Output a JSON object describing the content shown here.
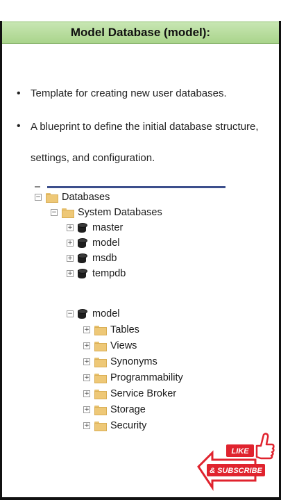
{
  "title": "Model Database (model):",
  "bullets": [
    "Template for creating new user databases.",
    "A blueprint to define the initial database structure, settings, and configuration."
  ],
  "tree": {
    "databases": "Databases",
    "system_databases": "System Databases",
    "system_items": [
      "master",
      "model",
      "msdb",
      "tempdb"
    ],
    "model_node": "model",
    "model_children": [
      "Tables",
      "Views",
      "Synonyms",
      "Programmability",
      "Service Broker",
      "Storage",
      "Security"
    ]
  },
  "badge": {
    "like": "LIKE",
    "subscribe": "& SUBSCRIBE",
    "colors": {
      "red": "#e0232e",
      "white": "#ffffff"
    }
  },
  "colors": {
    "banner": "#b5db98",
    "frame": "#111111",
    "folder": "#eec877"
  }
}
